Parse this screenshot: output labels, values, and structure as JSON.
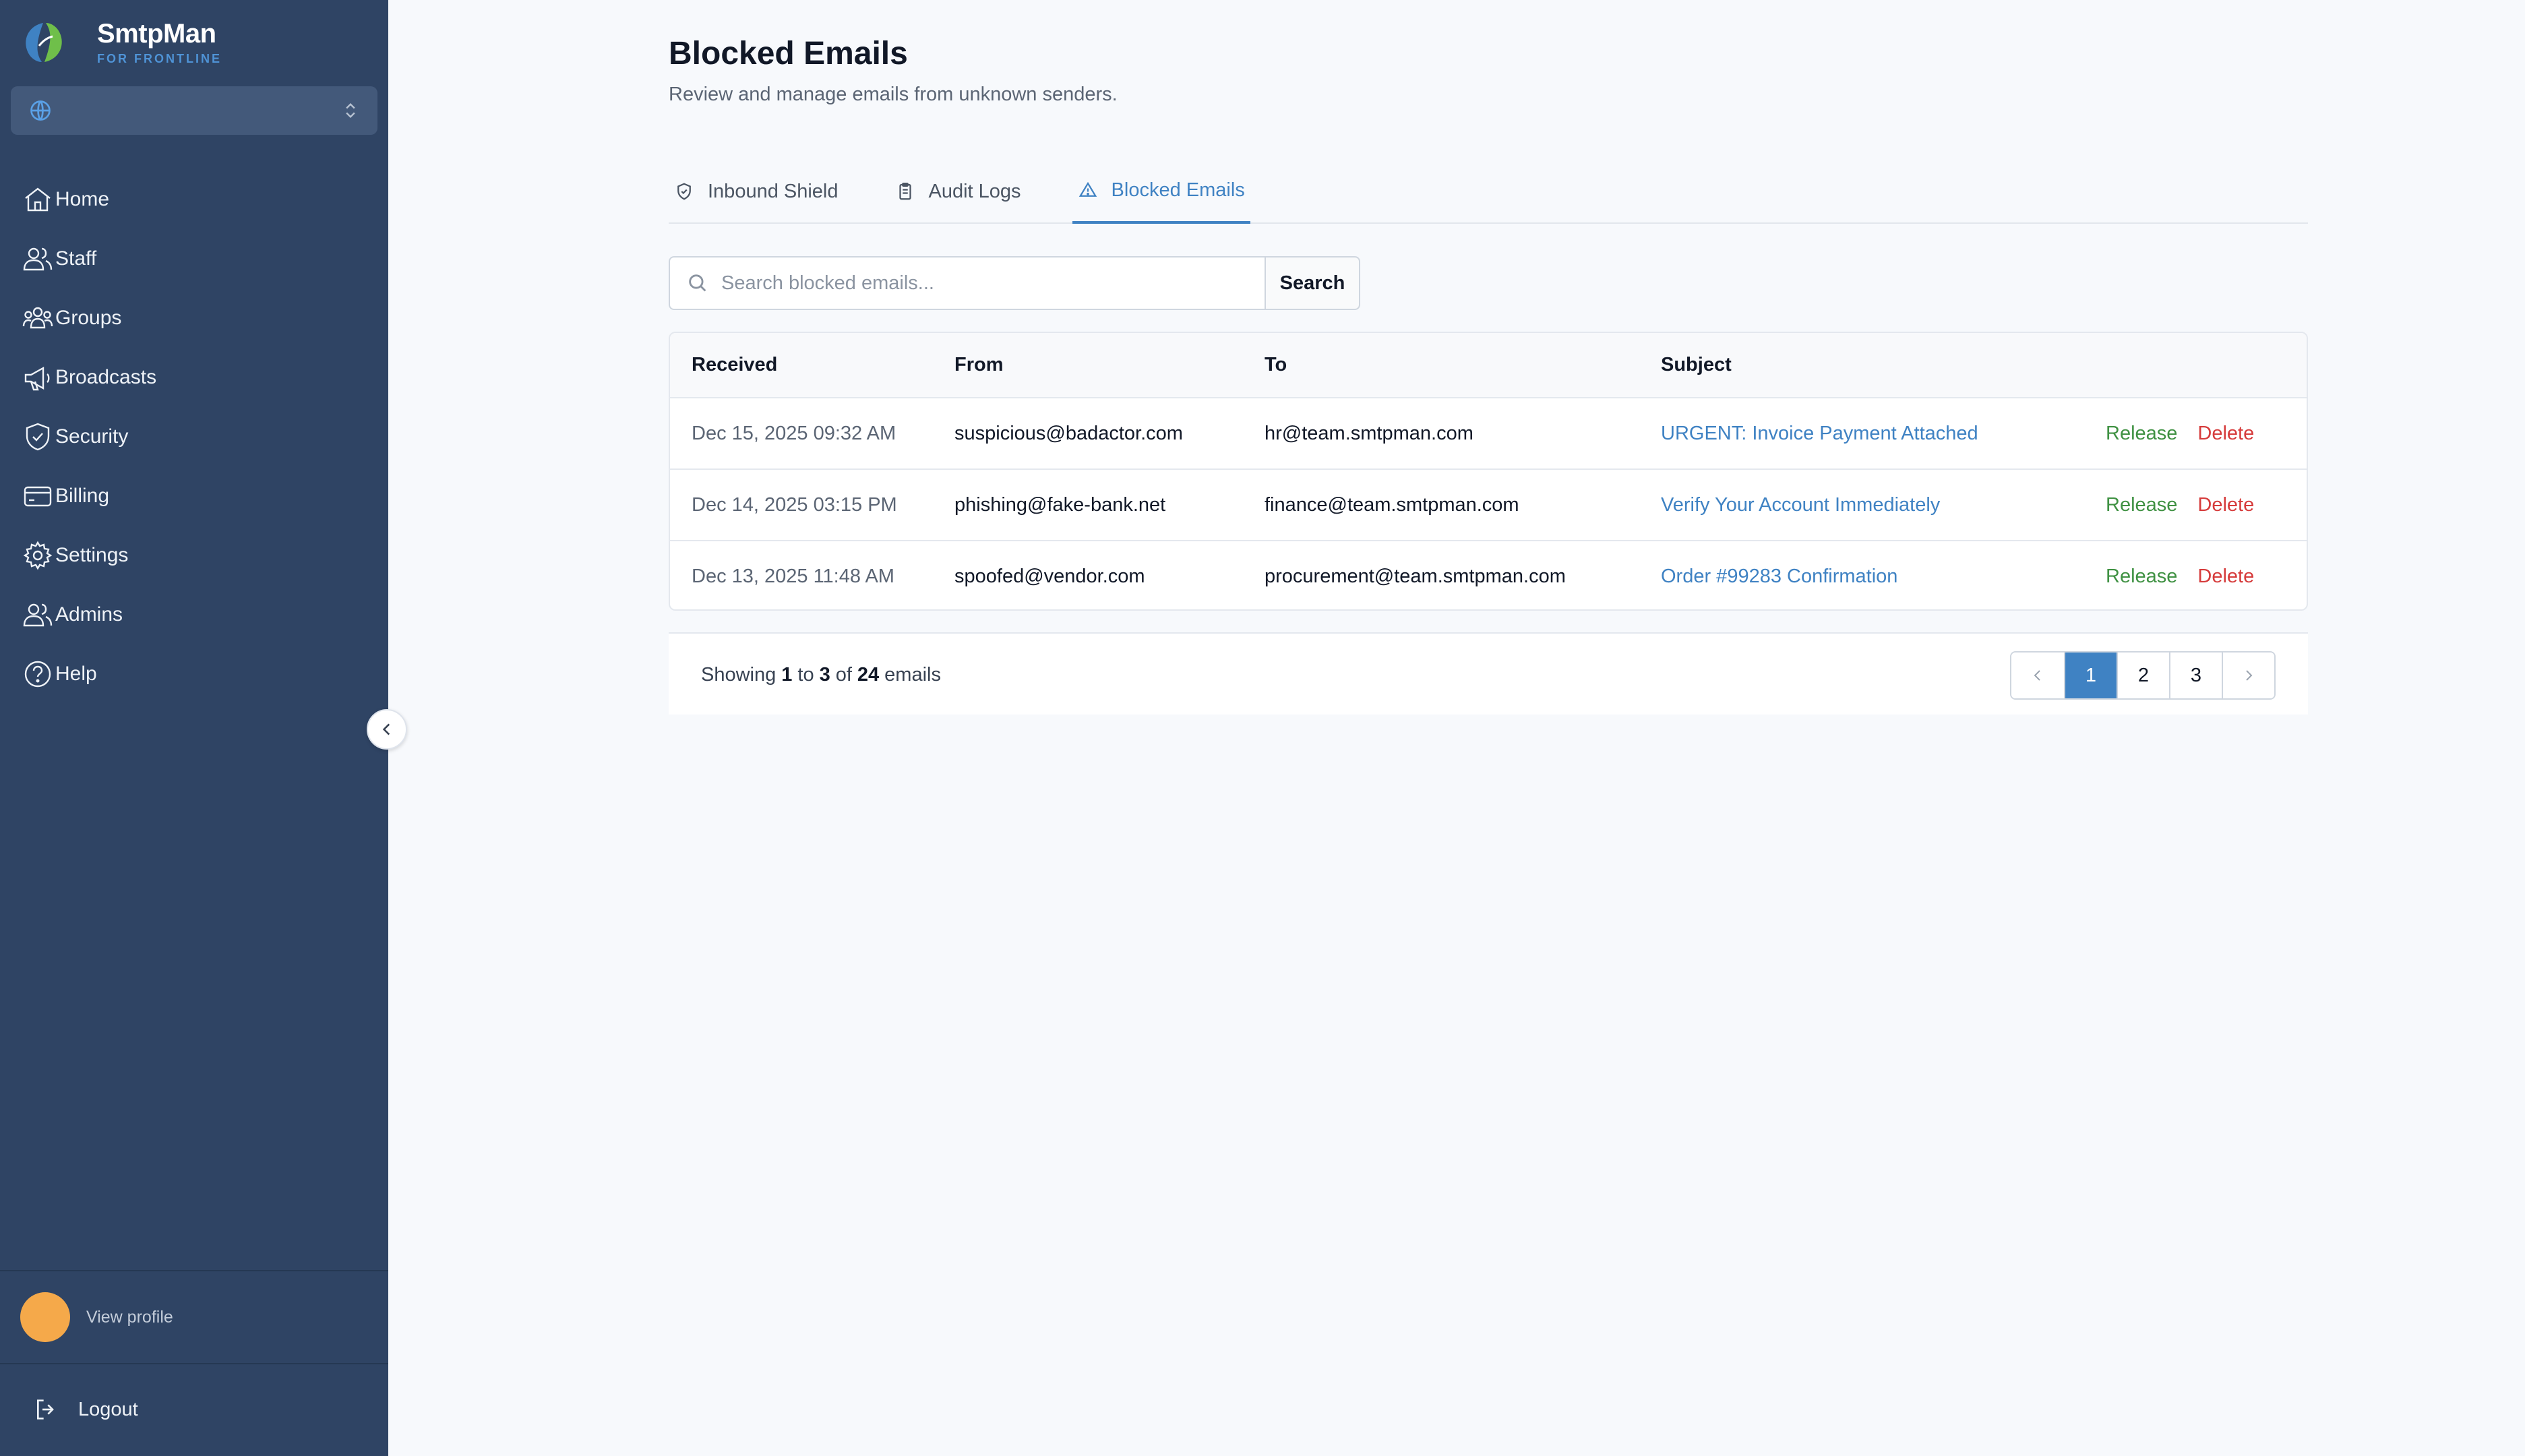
{
  "brand": {
    "name": "SmtpMan",
    "subtitle": "FOR FRONTLINE",
    "logo_icon": "smtpman-leaf-logo"
  },
  "org_selector": {
    "value": "",
    "icon": "globe-icon",
    "chevron": "chevrons-up-down-icon"
  },
  "sidebar": {
    "items": [
      {
        "label": "Home",
        "icon": "home-icon"
      },
      {
        "label": "Staff",
        "icon": "users-icon"
      },
      {
        "label": "Groups",
        "icon": "group-icon"
      },
      {
        "label": "Broadcasts",
        "icon": "megaphone-icon"
      },
      {
        "label": "Security",
        "icon": "shield-check-icon"
      },
      {
        "label": "Billing",
        "icon": "credit-card-icon"
      },
      {
        "label": "Settings",
        "icon": "gear-icon"
      },
      {
        "label": "Admins",
        "icon": "users-icon"
      },
      {
        "label": "Help",
        "icon": "help-circle-icon"
      }
    ],
    "collapse_icon": "chevron-left-icon",
    "profile_label": "View profile",
    "logout_label": "Logout"
  },
  "page": {
    "title": "Blocked Emails",
    "subtitle": "Review and manage emails from unknown senders."
  },
  "tabs": [
    {
      "label": "Inbound Shield",
      "icon": "shield-check-icon",
      "active": false
    },
    {
      "label": "Audit Logs",
      "icon": "clipboard-icon",
      "active": false
    },
    {
      "label": "Blocked Emails",
      "icon": "warning-triangle-icon",
      "active": true
    }
  ],
  "search": {
    "placeholder": "Search blocked emails...",
    "value": "",
    "button_label": "Search"
  },
  "table": {
    "headers": {
      "received": "Received",
      "from": "From",
      "to": "To",
      "subject": "Subject"
    },
    "rows": [
      {
        "received": "Dec 15, 2025 09:32 AM",
        "from": "suspicious@badactor.com",
        "to": "hr@team.smtpman.com",
        "subject": "URGENT: Invoice Payment Attached",
        "release": "Release",
        "delete": "Delete"
      },
      {
        "received": "Dec 14, 2025 03:15 PM",
        "from": "phishing@fake-bank.net",
        "to": "finance@team.smtpman.com",
        "subject": "Verify Your Account Immediately",
        "release": "Release",
        "delete": "Delete"
      },
      {
        "received": "Dec 13, 2025 11:48 AM",
        "from": "spoofed@vendor.com",
        "to": "procurement@team.smtpman.com",
        "subject": "Order #99283 Confirmation",
        "release": "Release",
        "delete": "Delete"
      }
    ]
  },
  "pagination": {
    "showing_prefix": "Showing",
    "from": "1",
    "to_word": "to",
    "to": "3",
    "of_word": "of",
    "total": "24",
    "suffix": "emails",
    "pages": [
      "1",
      "2",
      "3"
    ],
    "current_page": "1"
  },
  "colors": {
    "sidebar_bg": "#2f4464",
    "accent": "#3f82c3",
    "release": "#3f9142",
    "delete": "#d63b3b",
    "avatar": "#f5a94a"
  }
}
